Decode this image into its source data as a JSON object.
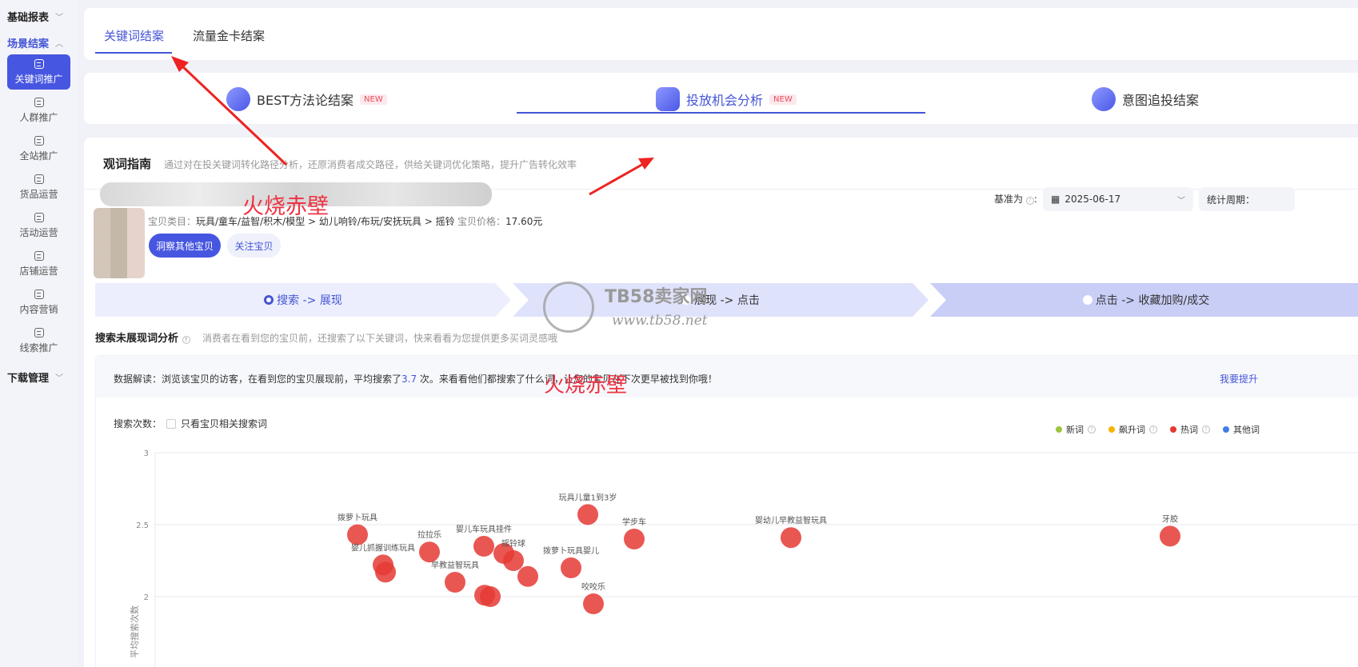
{
  "sidebar": {
    "groups": [
      {
        "label": "基础报表"
      },
      {
        "label": "场景结案"
      },
      {
        "label": "下载管理"
      }
    ],
    "items": [
      {
        "label": "关键词推广",
        "icon": "keyword-icon"
      },
      {
        "label": "人群推广",
        "icon": "crowd-icon"
      },
      {
        "label": "全站推广",
        "icon": "site-icon"
      },
      {
        "label": "货品运营",
        "icon": "goods-icon"
      },
      {
        "label": "活动运营",
        "icon": "activity-icon"
      },
      {
        "label": "店铺运营",
        "icon": "shop-icon"
      },
      {
        "label": "内容营销",
        "icon": "content-icon"
      },
      {
        "label": "线索推广",
        "icon": "lead-icon"
      }
    ]
  },
  "top_tabs": [
    {
      "label": "关键词结案"
    },
    {
      "label": "流量金卡结案"
    }
  ],
  "second_tabs": [
    {
      "label": "BEST方法论结案",
      "badge": "NEW"
    },
    {
      "label": "投放机会分析",
      "badge": "NEW"
    },
    {
      "label": "意图追投结案"
    }
  ],
  "guide": {
    "title": "观词指南",
    "subtitle": "通过对在投关键词转化路径分析，还原消费者成交路径，供给关键词优化策略，提升广告转化效率"
  },
  "product": {
    "watermark": "火烧赤壁",
    "category_label": "宝贝类目：",
    "category": "玩具/童车/益智/积木/模型 > 幼儿响铃/布玩/安抚玩具 > 摇铃",
    "price_label": "宝贝价格：",
    "price": "17.60元",
    "insight_button": "洞察其他宝贝",
    "follow_button": "关注宝贝"
  },
  "filters": {
    "base_label": "基准为",
    "date": "2025-06-17",
    "period_label": "统计周期："
  },
  "steps": [
    {
      "label": "搜索 -> 展现"
    },
    {
      "label": "展现 -> 点击"
    },
    {
      "label": "点击 -> 收藏加购/成交"
    }
  ],
  "site_watermark": {
    "name": "TB58卖家网",
    "url": "www.tb58.net"
  },
  "analysis": {
    "title": "搜索未展现词分析",
    "desc": "消费者在看到您的宝贝前，还搜索了以下关键词，快来看看为您提供更多买词灵感哦",
    "notice_prefix": "数据解读：浏览该宝贝的访客，在看到您的宝贝展现前，平均搜索了",
    "notice_num": "3.7",
    "notice_suffix": " 次。来看看他们都搜索了什么词，让您的宝贝在下次更早被找到你哦！",
    "notice_watermark": "火烧赤壁",
    "notice_link": "我要提升",
    "filter_label": "搜索次数：",
    "checkbox_label": "只看宝贝相关搜索词"
  },
  "legend": [
    {
      "label": "新词",
      "color": "#9bc53d"
    },
    {
      "label": "飙升词",
      "color": "#f6b400"
    },
    {
      "label": "热词",
      "color": "#e53935"
    },
    {
      "label": "其他词",
      "color": "#3f7ee8"
    }
  ],
  "chart_data": {
    "type": "scatter",
    "ylabel": "平均搜索次数",
    "yticks": [
      "3",
      "2.5",
      "2"
    ],
    "ylim": [
      2,
      3
    ],
    "grid": true,
    "series": [
      {
        "name": "热词",
        "color": "#e53935",
        "points": [
          {
            "label": "拨萝卜玩具",
            "x": 447,
            "y": 2.43
          },
          {
            "label": "婴儿抓握训练玩具",
            "x": 479,
            "y": 2.22
          },
          {
            "label": "",
            "x": 482,
            "y": 2.17
          },
          {
            "label": "拉拉乐",
            "x": 537,
            "y": 2.31
          },
          {
            "label": "早教益智玩具",
            "x": 569,
            "y": 2.1
          },
          {
            "label": "婴儿车玩具挂件",
            "x": 605,
            "y": 2.35
          },
          {
            "label": "",
            "x": 606,
            "y": 2.01
          },
          {
            "label": "",
            "x": 613,
            "y": 2.0
          },
          {
            "label": "",
            "x": 630,
            "y": 2.3
          },
          {
            "label": "摇铃球",
            "x": 642,
            "y": 2.25
          },
          {
            "label": "",
            "x": 660,
            "y": 2.14
          },
          {
            "label": "拨萝卜玩具婴儿",
            "x": 714,
            "y": 2.2
          },
          {
            "label": "玩具儿童1到3岁",
            "x": 735,
            "y": 2.57
          },
          {
            "label": "咬咬乐",
            "x": 742,
            "y": 1.95
          },
          {
            "label": "学步车",
            "x": 793,
            "y": 2.4
          },
          {
            "label": "婴幼儿早教益智玩具",
            "x": 989,
            "y": 2.41
          },
          {
            "label": "牙胶",
            "x": 1463,
            "y": 2.42
          }
        ]
      }
    ]
  }
}
